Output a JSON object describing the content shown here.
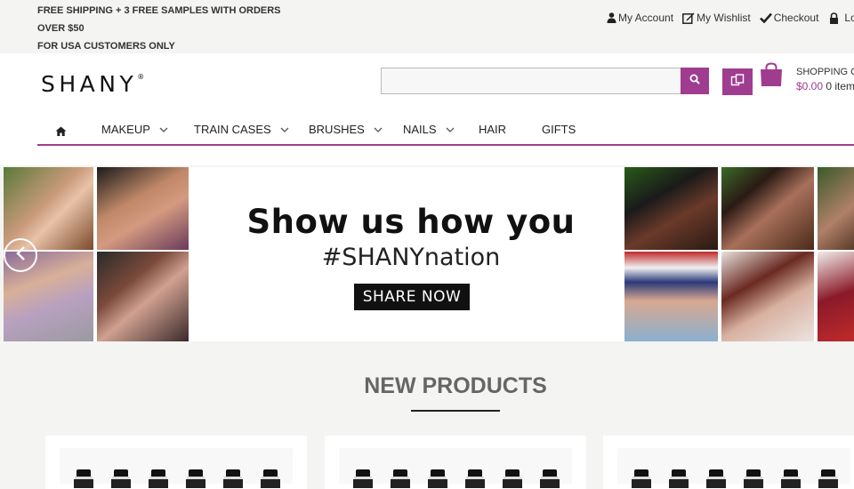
{
  "topbar": {
    "promo_line1": "FREE SHIPPING + 3 FREE SAMPLES WITH ORDERS",
    "promo_line2": "OVER $50",
    "promo_line3": "FOR USA CUSTOMERS ONLY",
    "links": {
      "account": "My Account",
      "wishlist": "My Wishlist",
      "checkout": "Checkout",
      "login": "Lo"
    }
  },
  "header": {
    "logo_text": "SHANY",
    "logo_mark": "®",
    "search_value": "",
    "cart_label": "SHOPPING C",
    "cart_price": "$0.00",
    "cart_items": "0 item"
  },
  "nav": {
    "items": [
      {
        "label": "MAKEUP",
        "has_dropdown": true
      },
      {
        "label": "TRAIN CASES",
        "has_dropdown": true
      },
      {
        "label": "BRUSHES",
        "has_dropdown": true
      },
      {
        "label": "NAILS",
        "has_dropdown": true
      },
      {
        "label": "HAIR",
        "has_dropdown": false
      },
      {
        "label": "GIFTS",
        "has_dropdown": false
      }
    ]
  },
  "banner": {
    "headline": "Show us how you",
    "hashtag": "#SHANYnation",
    "button_label": "SHARE NOW"
  },
  "new_products": {
    "title": "NEW PRODUCTS"
  },
  "colors": {
    "accent": "#a03c8f",
    "text": "#333333",
    "background": "#f4f4f2"
  }
}
